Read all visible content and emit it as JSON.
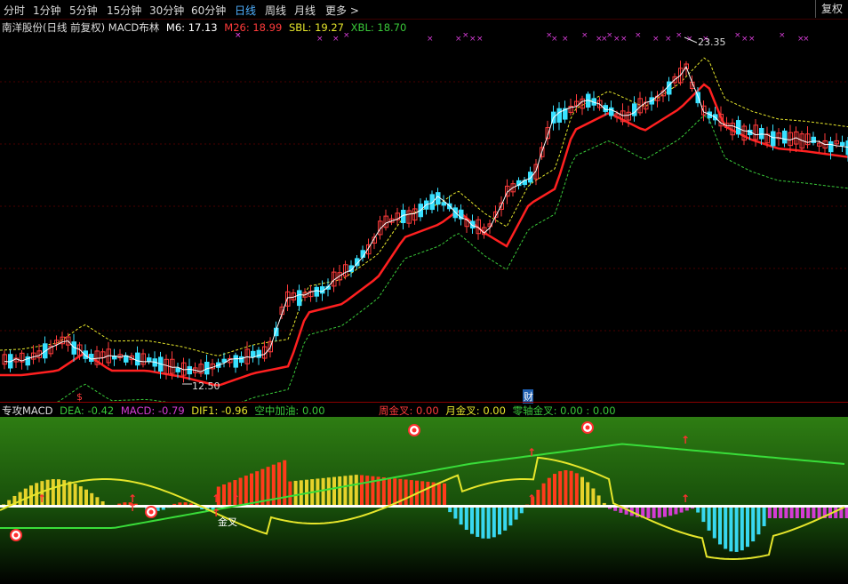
{
  "toolbar": {
    "periods": [
      "分时",
      "1分钟",
      "5分钟",
      "15分钟",
      "30分钟",
      "60分钟",
      "日线",
      "周线",
      "月线",
      "更多 >"
    ],
    "active": "日线",
    "right_button": "复权"
  },
  "main_legend": {
    "title": "南洋股份(日线 前复权) MACD布林",
    "m6": "M6: 17.13",
    "m26": "M26: 18.99",
    "sbl": "SBL: 19.27",
    "xbl": "XBL: 18.70"
  },
  "annotations": {
    "high": "23.35",
    "low": "12.50",
    "event_marker_1": "$",
    "event_marker_2": "财"
  },
  "sub_legend": {
    "title": "专攻MACD",
    "dea": "DEA: -0.42",
    "macd": "MACD: -0.79",
    "dif": "DIF1: -0.96",
    "air": "空中加油: 0.00",
    "week_cross": "周金叉: 0.00",
    "month_cross": "月金叉: 0.00",
    "zero_cross": "零轴金叉: 0.00 : 0.00",
    "golden_cross_label": "金叉"
  },
  "colors": {
    "background": "#000000",
    "up_candle": "#ff3b3b",
    "down_candle": "#38e1ff",
    "m6": "#ffffff",
    "m26": "#ff2020",
    "sbl": "#e6e62b",
    "xbl": "#39c939",
    "sub_bg": "#1f6b10"
  }
}
